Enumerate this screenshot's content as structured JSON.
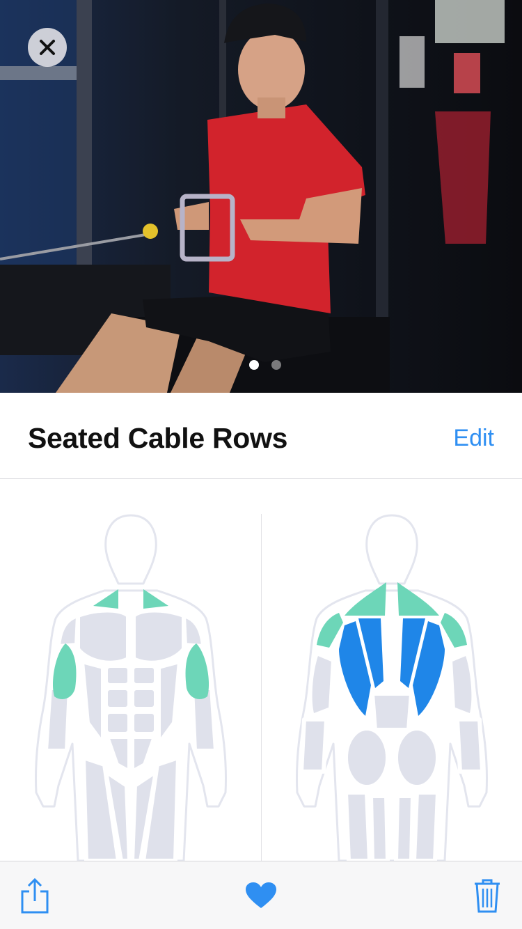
{
  "header": {
    "close_icon": "close-icon",
    "photo_dots": {
      "count": 2,
      "active_index": 0
    }
  },
  "exercise": {
    "title": "Seated Cable Rows",
    "edit_label": "Edit"
  },
  "muscle_map": {
    "primary_color": "#1f86e8",
    "secondary_color": "#6dd6b8",
    "inactive_color": "#dfe1eb",
    "front_highlights": [
      "trapezius",
      "biceps"
    ],
    "back_highlights": [
      "latissimus-dorsi",
      "trapezius",
      "rear-deltoids"
    ]
  },
  "toolbar": {
    "share_icon": "share-icon",
    "favorite_icon": "heart-icon",
    "delete_icon": "trash-icon",
    "accent_color": "#2f8ff2"
  }
}
